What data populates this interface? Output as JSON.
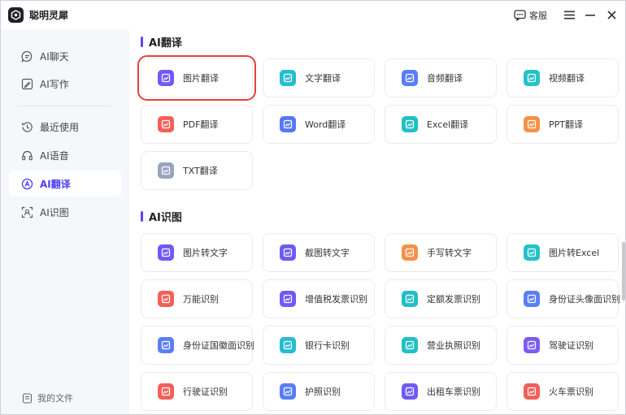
{
  "app": {
    "title": "聪明灵犀",
    "kefu_label": "客服"
  },
  "sidebar": {
    "items": [
      {
        "label": "AI聊天",
        "icon": "chat-icon"
      },
      {
        "label": "AI写作",
        "icon": "write-icon"
      },
      {
        "label": "最近使用",
        "icon": "history-icon"
      },
      {
        "label": "AI语音",
        "icon": "headset-icon"
      },
      {
        "label": "AI翻译",
        "icon": "translate-icon",
        "active": true
      },
      {
        "label": "AI识图",
        "icon": "scan-icon"
      }
    ],
    "footer": {
      "label": "我的文件",
      "icon": "file-icon"
    }
  },
  "sections": {
    "translate": {
      "title": "AI翻译",
      "cards": [
        {
          "label": "图片翻译",
          "icon": "image-icon",
          "color": "#6f5af6"
        },
        {
          "label": "文字翻译",
          "icon": "text-icon",
          "color": "#27bcd0"
        },
        {
          "label": "音频翻译",
          "icon": "audio-icon",
          "color": "#5a7ef7"
        },
        {
          "label": "视频翻译",
          "icon": "video-icon",
          "color": "#25c2c6"
        },
        {
          "label": "PDF翻译",
          "icon": "pdf-icon",
          "color": "#f2605a"
        },
        {
          "label": "Word翻译",
          "icon": "word-icon",
          "color": "#5878f2"
        },
        {
          "label": "Excel翻译",
          "icon": "excel-icon",
          "color": "#22bfc4"
        },
        {
          "label": "PPT翻译",
          "icon": "ppt-icon",
          "color": "#f5924a"
        },
        {
          "label": "TXT翻译",
          "icon": "txt-icon",
          "color": "#9aa4bf"
        }
      ]
    },
    "recognize": {
      "title": "AI识图",
      "cards": [
        {
          "label": "图片转文字",
          "icon": "image-text-icon",
          "color": "#6f5af6"
        },
        {
          "label": "截图转文字",
          "icon": "screenshot-icon",
          "color": "#6d5cf3"
        },
        {
          "label": "手写转文字",
          "icon": "handwrite-icon",
          "color": "#f5924a"
        },
        {
          "label": "图片转Excel",
          "icon": "image-excel-icon",
          "color": "#25c2c6"
        },
        {
          "label": "万能识别",
          "icon": "universal-icon",
          "color": "#f2605a"
        },
        {
          "label": "增值税发票识别",
          "icon": "invoice-icon",
          "color": "#6f5af6"
        },
        {
          "label": "定额发票识别",
          "icon": "quota-invoice-icon",
          "color": "#22bfc4"
        },
        {
          "label": "身份证头像面识别",
          "icon": "id-front-icon",
          "color": "#5a7ef7"
        },
        {
          "label": "身份证国徽面识别",
          "icon": "id-back-icon",
          "color": "#5a7ef7"
        },
        {
          "label": "银行卡识别",
          "icon": "bank-card-icon",
          "color": "#27bcd0"
        },
        {
          "label": "营业执照识别",
          "icon": "license-icon",
          "color": "#22bfc4"
        },
        {
          "label": "驾驶证识别",
          "icon": "driver-license-icon",
          "color": "#7c5cf5"
        },
        {
          "label": "行驶证识别",
          "icon": "vehicle-license-icon",
          "color": "#f2605a"
        },
        {
          "label": "护照识别",
          "icon": "passport-icon",
          "color": "#5a7ef7"
        },
        {
          "label": "出租车票识别",
          "icon": "taxi-icon",
          "color": "#6f5af6"
        },
        {
          "label": "火车票识别",
          "icon": "train-icon",
          "color": "#f2605a"
        }
      ]
    }
  },
  "colors": {
    "accent": "#4b3df0",
    "selection_outline": "#e0433a"
  }
}
